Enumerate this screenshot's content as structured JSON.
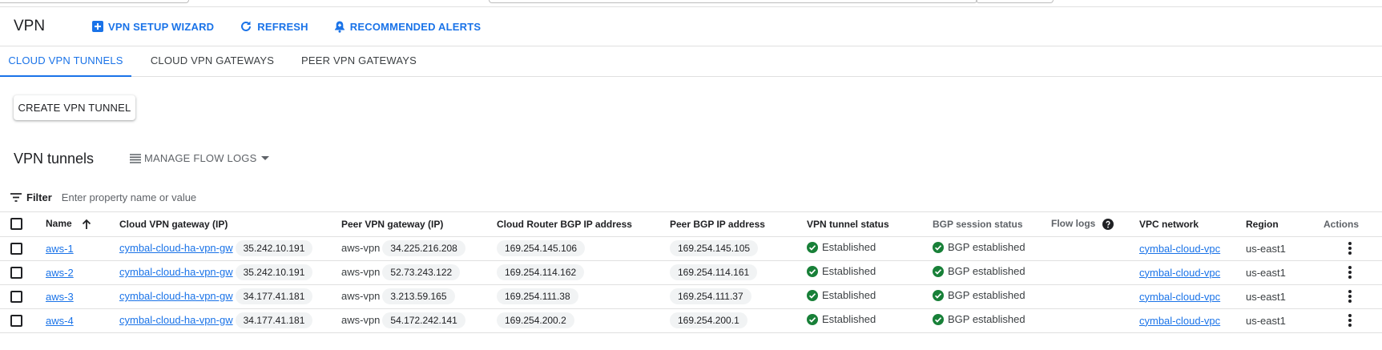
{
  "header": {
    "title": "VPN",
    "buttons": [
      {
        "label": "VPN SETUP WIZARD",
        "icon": "add-box-icon"
      },
      {
        "label": "REFRESH",
        "icon": "refresh-icon"
      },
      {
        "label": "RECOMMENDED ALERTS",
        "icon": "alert-bell-icon"
      }
    ]
  },
  "tabs": [
    {
      "label": "CLOUD VPN TUNNELS",
      "active": true
    },
    {
      "label": "CLOUD VPN GATEWAYS",
      "active": false
    },
    {
      "label": "PEER VPN GATEWAYS",
      "active": false
    }
  ],
  "create_button": "CREATE VPN TUNNEL",
  "section": {
    "title": "VPN tunnels",
    "manage_flow_logs": "MANAGE FLOW LOGS"
  },
  "filter": {
    "label": "Filter",
    "placeholder": "Enter property name or value"
  },
  "columns": {
    "name": "Name",
    "cloud_gw": "Cloud VPN gateway (IP)",
    "peer_gw": "Peer VPN gateway (IP)",
    "router_bgp": "Cloud Router BGP IP address",
    "peer_bgp": "Peer BGP IP address",
    "tunnel_status": "VPN tunnel status",
    "bgp_status": "BGP session status",
    "flow_logs": "Flow logs",
    "vpc": "VPC network",
    "region": "Region",
    "actions": "Actions"
  },
  "rows": [
    {
      "name": "aws-1",
      "cloud_gw_name": "cymbal-cloud-ha-vpn-gw",
      "cloud_gw_ip": "35.242.10.191",
      "peer_gw_name": "aws-vpn",
      "peer_gw_ip": "34.225.216.208",
      "router_bgp": "169.254.145.106",
      "peer_bgp": "169.254.145.105",
      "tunnel_status": "Established",
      "bgp_status": "BGP established",
      "vpc": "cymbal-cloud-vpc",
      "region": "us-east1"
    },
    {
      "name": "aws-2",
      "cloud_gw_name": "cymbal-cloud-ha-vpn-gw",
      "cloud_gw_ip": "35.242.10.191",
      "peer_gw_name": "aws-vpn",
      "peer_gw_ip": "52.73.243.122",
      "router_bgp": "169.254.114.162",
      "peer_bgp": "169.254.114.161",
      "tunnel_status": "Established",
      "bgp_status": "BGP established",
      "vpc": "cymbal-cloud-vpc",
      "region": "us-east1"
    },
    {
      "name": "aws-3",
      "cloud_gw_name": "cymbal-cloud-ha-vpn-gw",
      "cloud_gw_ip": "34.177.41.181",
      "peer_gw_name": "aws-vpn",
      "peer_gw_ip": "3.213.59.165",
      "router_bgp": "169.254.111.38",
      "peer_bgp": "169.254.111.37",
      "tunnel_status": "Established",
      "bgp_status": "BGP established",
      "vpc": "cymbal-cloud-vpc",
      "region": "us-east1"
    },
    {
      "name": "aws-4",
      "cloud_gw_name": "cymbal-cloud-ha-vpn-gw",
      "cloud_gw_ip": "34.177.41.181",
      "peer_gw_name": "aws-vpn",
      "peer_gw_ip": "54.172.242.141",
      "router_bgp": "169.254.200.2",
      "peer_bgp": "169.254.200.1",
      "tunnel_status": "Established",
      "bgp_status": "BGP established",
      "vpc": "cymbal-cloud-vpc",
      "region": "us-east1"
    }
  ],
  "colors": {
    "accent": "#1a73e8",
    "success": "#188038",
    "text": "#202124",
    "muted": "#5f6368"
  }
}
